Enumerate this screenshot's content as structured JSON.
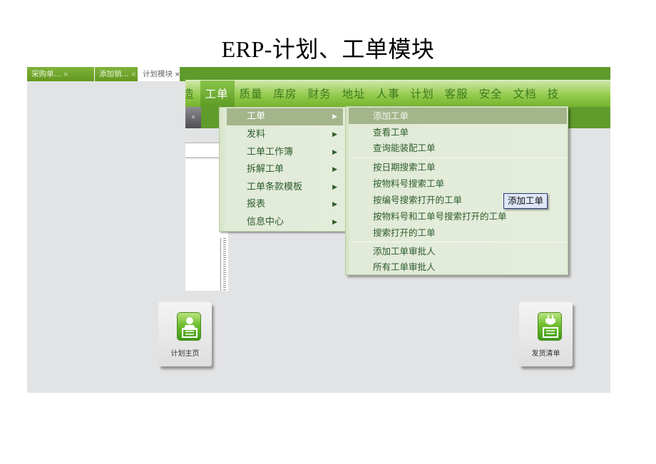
{
  "document": {
    "title": "ERP-计划、工单模块"
  },
  "tabs": [
    {
      "label": "采购单...",
      "close": "×",
      "active": false
    },
    {
      "label": "添加销...",
      "close": "×",
      "active": false
    },
    {
      "label": "计划模块",
      "close": "×",
      "active": true
    }
  ],
  "topnav": {
    "items": [
      "造",
      "工单",
      "质量",
      "库房",
      "财务",
      "地址",
      "人事",
      "计划",
      "客服",
      "安全",
      "文档",
      "技"
    ],
    "active_index": 1
  },
  "collapse_button": {
    "glyph": "«"
  },
  "menu_level1": {
    "items": [
      {
        "label": "工单",
        "has_submenu": true,
        "active": true
      },
      {
        "label": "发料",
        "has_submenu": true
      },
      {
        "label": "工单工作簿",
        "has_submenu": true
      },
      {
        "label": "拆解工单",
        "has_submenu": true
      },
      {
        "label": "工单条款模板",
        "has_submenu": true
      },
      {
        "label": "报表",
        "has_submenu": true
      },
      {
        "label": "信息中心",
        "has_submenu": true
      }
    ],
    "arrow_glyph": "▶"
  },
  "menu_level2": {
    "groups": [
      [
        "添加工单",
        "查看工单",
        "查询能装配工单"
      ],
      [
        "按日期搜索工单",
        "按物料号搜索工单",
        "按编号搜索打开的工单",
        "按物料号和工单号搜索打开的工单",
        "搜索打开的工单"
      ],
      [
        "添加工单审批人",
        "所有工单审批人"
      ]
    ],
    "active_item": "添加工单"
  },
  "tooltip": {
    "text": "添加工单"
  },
  "shortcuts": [
    {
      "label": "计划主页",
      "icon": "person-id-card-icon"
    },
    {
      "label": "发货清单",
      "icon": "plug-id-card-icon"
    }
  ],
  "colors": {
    "nav_green": "#8cc643",
    "dark_green": "#609c2c",
    "menu_bg": "#e4ecdb",
    "menu_highlight": "#a4b58b",
    "workspace_bg": "#e2e3e4"
  }
}
